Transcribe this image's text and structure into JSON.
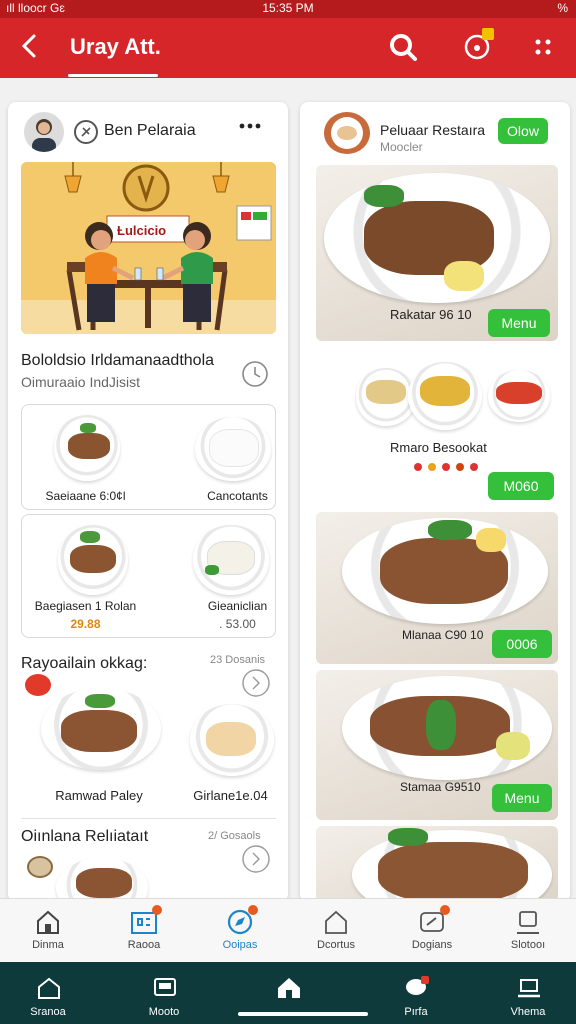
{
  "status_bar": {
    "left": "ıll lloocr  Gɛ",
    "time": "15:35 PM",
    "right": "%"
  },
  "app_bar": {
    "title": "Uray Att."
  },
  "left_panel": {
    "profile_name": "Ben Pelaraia",
    "banner_sign": "Ƚulcicio",
    "section_title": "Bololdsio Irldamanaadthola",
    "section_subtitle": "Oimuraaio IndJisist",
    "cards": [
      {
        "label": "Saeiaane 6:0¢l",
        "price": ""
      },
      {
        "label": "Cancotants",
        "price": ""
      },
      {
        "label": "Baegiasen 1 Rolan",
        "price": "29.88"
      },
      {
        "label": "Gieaniclian",
        "price": ". 53.00"
      }
    ],
    "recommend_title": "Rayoailain okkag:",
    "recommend_meta": "23 Dosanis",
    "recommend_items": [
      {
        "label": "Ramwad Paley"
      },
      {
        "label": "Girlane1e.04"
      }
    ],
    "next_title": "Oiınlana Relıiataıt",
    "next_meta": "2/ Gosaols"
  },
  "right_panel": {
    "restaurant_name": "Peluaar Restaıra",
    "restaurant_sub": "Moocler",
    "header_button": "Olow",
    "items": [
      {
        "label": "Rakatar 96 10",
        "button": "Menu"
      },
      {
        "label": "Rmaro Besookat",
        "button": "M060"
      },
      {
        "label": "Mlanaa C90 10",
        "button": "0006"
      },
      {
        "label": "Stamaa G9510",
        "button": "Menu"
      }
    ]
  },
  "tabs": [
    {
      "label": "Dinma"
    },
    {
      "label": "Raooa"
    },
    {
      "label": "Ooipas"
    },
    {
      "label": "Dcortus"
    },
    {
      "label": "Dogians"
    },
    {
      "label": "Slotooı"
    }
  ],
  "system_nav": [
    {
      "label": "Sranoa"
    },
    {
      "label": "Mooto"
    },
    {
      "label": ""
    },
    {
      "label": "Pırfa"
    },
    {
      "label": "Vhema"
    }
  ],
  "colors": {
    "primary": "#d7262a",
    "accent_green": "#34c03a",
    "active_tab": "#1a86c9",
    "nav_dark": "#0f3a3c"
  }
}
